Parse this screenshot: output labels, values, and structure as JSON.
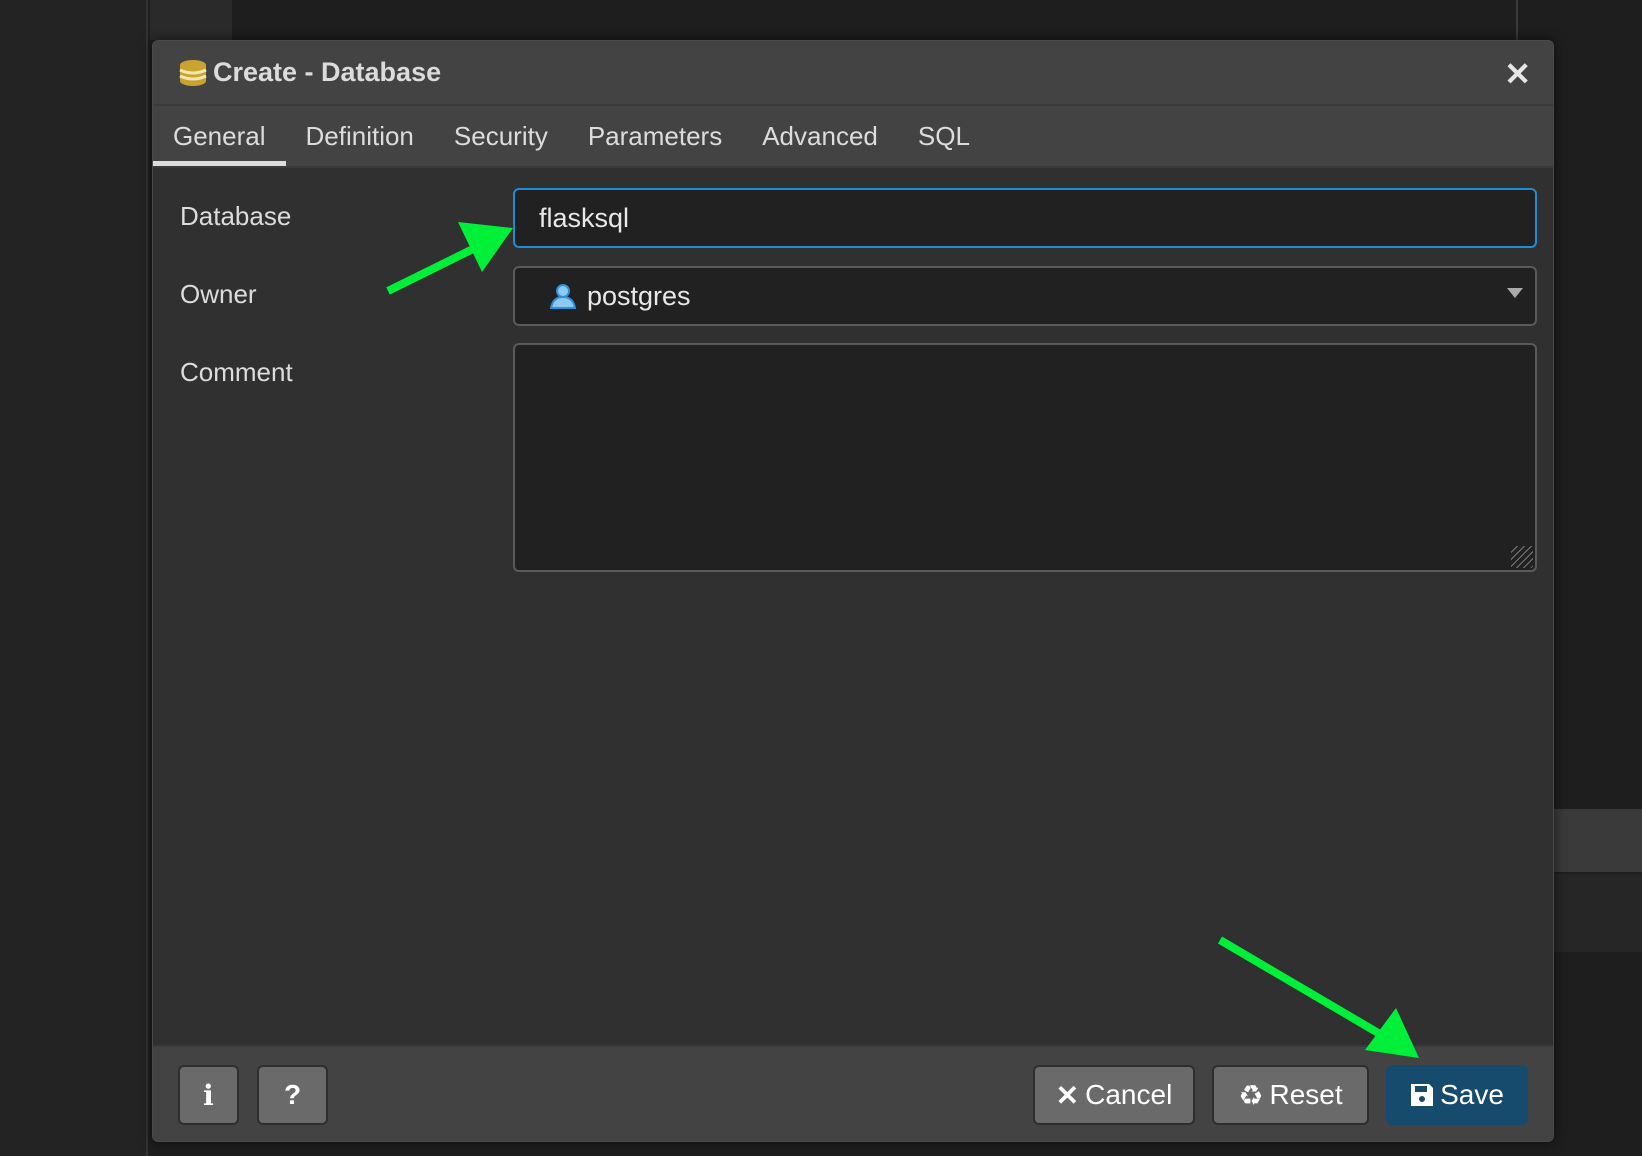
{
  "dialog": {
    "title": "Create - Database",
    "close_icon": "close-icon"
  },
  "tabs": [
    {
      "label": "General",
      "active": true
    },
    {
      "label": "Definition"
    },
    {
      "label": "Security"
    },
    {
      "label": "Parameters"
    },
    {
      "label": "Advanced"
    },
    {
      "label": "SQL"
    }
  ],
  "form": {
    "database_label": "Database",
    "database_value": "flasksql",
    "owner_label": "Owner",
    "owner_value": "postgres",
    "comment_label": "Comment",
    "comment_value": ""
  },
  "footer": {
    "info_label": "i",
    "help_label": "?",
    "cancel_label": "Cancel",
    "reset_label": "Reset",
    "save_label": "Save"
  },
  "colors": {
    "accent": "#1f8dd6",
    "save": "#164b6d",
    "annotation_arrow": "#00f03a",
    "db_icon": "#c8a332"
  }
}
